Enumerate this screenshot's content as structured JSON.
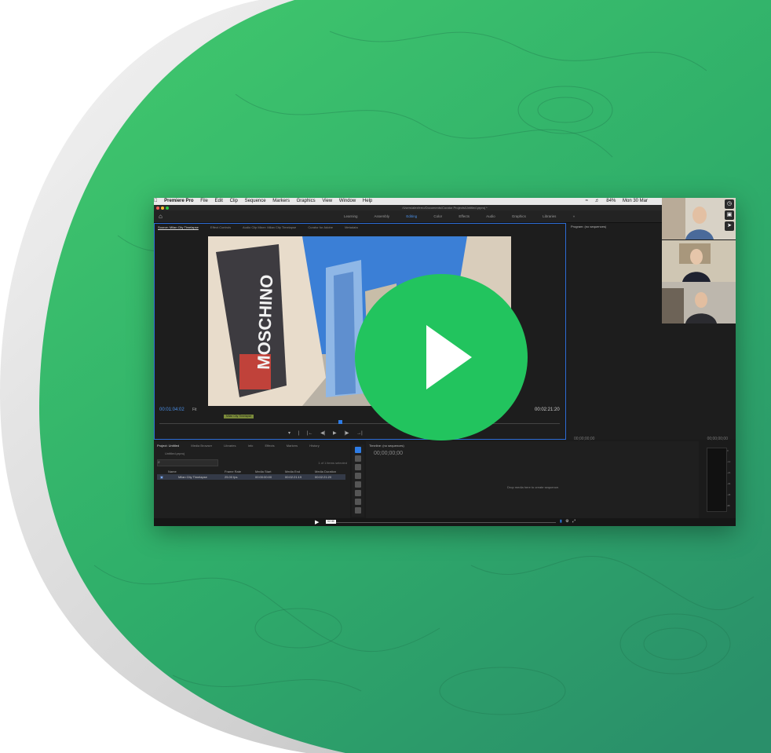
{
  "colors": {
    "brand_green": "#3cc46d",
    "selection_blue": "#2d7ce6",
    "play_button_green": "#22c45e"
  },
  "menubar": {
    "apple": "",
    "app_name": "Premiere Pro",
    "items": [
      "File",
      "Edit",
      "Clip",
      "Sequence",
      "Markers",
      "Graphics",
      "View",
      "Window",
      "Help"
    ],
    "battery": "84%",
    "clock": "Mon 30 Mar"
  },
  "window_title": "/Users/alexferro/Documents/Curator Projects/Untitled.prproj *",
  "workspaces": {
    "home_icon": "home-icon",
    "tabs": [
      "Learning",
      "Assembly",
      "Editing",
      "Color",
      "Effects",
      "Audio",
      "Graphics",
      "Libraries"
    ],
    "overflow": "»"
  },
  "source": {
    "tabs": [
      "Source: Milan City Timelapse",
      "Effect Controls",
      "Audio Clip Mixer: Milan City Timelapse",
      "Curator for Adobe",
      "Metadata"
    ],
    "timecode": "00:01:04:02",
    "fit": "Fit",
    "duration": "00:02:21:20",
    "clip_label": "Milan City Timelapse",
    "sign_text": "MOSCHINO"
  },
  "program": {
    "title": "Program: (no sequences)",
    "tc_left": "00;00;00;00",
    "tc_right": "00;00;00;00"
  },
  "project": {
    "tabs": [
      "Project: Untitled",
      "Media Browser",
      "Libraries",
      "Info",
      "Effects",
      "Markers",
      "History"
    ],
    "file": "Untitled.prproj",
    "items_selected": "1 of 1 items selected",
    "columns": [
      "Name",
      "Frame Rate",
      "Media Start",
      "Media End",
      "Media Duration"
    ],
    "row": {
      "name": "Milan City Timelapse",
      "frame_rate": "25.00 fps",
      "media_start": "00:00:00:00",
      "media_end": "00:02:21:19",
      "media_duration": "00:02:21:20"
    }
  },
  "timeline": {
    "title": "Timeline: (no sequences)",
    "timecode": "00;00;00;00",
    "empty_message": "Drop media here to create sequence."
  },
  "meters": {
    "scale": [
      "0",
      "-12",
      "-24",
      "-36",
      "-48",
      "dB"
    ]
  },
  "bottombar": {
    "play": "▶",
    "badge": "02:30"
  },
  "video_call": {
    "participants": 3
  },
  "overlay": {
    "icon": "play-icon"
  }
}
